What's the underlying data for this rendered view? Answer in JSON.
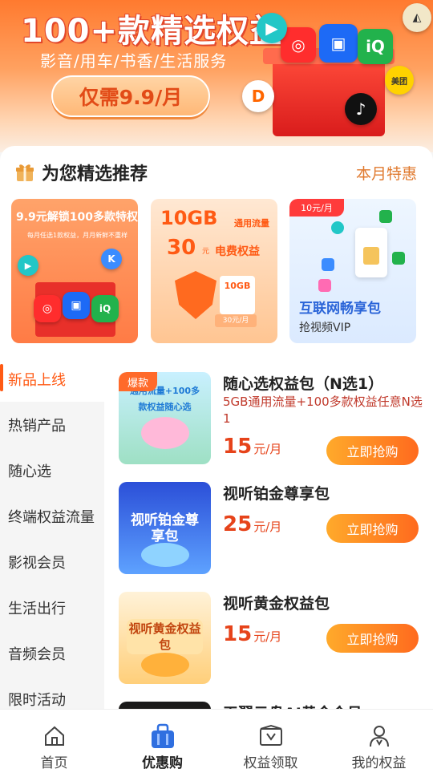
{
  "colors": {
    "accent": "#ff5a14",
    "price": "#e6431a",
    "buy_gradient_start": "#ffaa2b",
    "buy_gradient_end": "#ff6a1e",
    "section_more": "#e07a2f"
  },
  "banner": {
    "title": "100+款精选权益",
    "subtitle": "影音/用车/书香/生活服务",
    "cta": "仅需9.9/月",
    "icons": [
      "netease-music-icon",
      "youku-icon",
      "iqiyi-icon",
      "tiktok-icon",
      "meituan-icon",
      "didi-icon",
      "tencent-video-icon",
      "petrochina-icon"
    ]
  },
  "recommend": {
    "title": "为您精选推荐",
    "more": "本月特惠",
    "cards": [
      {
        "title": "9.9元解锁100多款特权",
        "subtitle": "每月任选1款权益，月月新鲜不重样"
      },
      {
        "big": "10GB",
        "small": "通用流量",
        "amount": "30",
        "yuan": "元",
        "benefit": "电费权益",
        "tag": "10GB",
        "price": "30元/月"
      },
      {
        "tag": "10元/月",
        "title": "互联网畅享包",
        "subtitle": "抢视频VIP"
      }
    ]
  },
  "categories": [
    {
      "label": "新品上线",
      "active": true
    },
    {
      "label": "热销产品",
      "active": false
    },
    {
      "label": "随心选",
      "active": false
    },
    {
      "label": "终端权益流量",
      "active": false
    },
    {
      "label": "影视会员",
      "active": false
    },
    {
      "label": "生活出行",
      "active": false
    },
    {
      "label": "音频会员",
      "active": false
    },
    {
      "label": "限时活动",
      "active": false
    }
  ],
  "products": [
    {
      "badge": "爆款",
      "thumb_label": "通用流量+100多款权益随心选",
      "title": "随心选权益包（N选1）",
      "desc": "5GB通用流量+100多款权益任意N选1",
      "price": "15",
      "unit": "元/月",
      "button": "立即抢购"
    },
    {
      "badge": "",
      "thumb_label": "视听铂金尊享包",
      "title": "视听铂金尊享包",
      "desc": "",
      "price": "25",
      "unit": "元/月",
      "button": "立即抢购"
    },
    {
      "badge": "",
      "thumb_label": "视听黄金权益包",
      "title": "视听黄金权益包",
      "desc": "",
      "price": "15",
      "unit": "元/月",
      "button": "立即抢购"
    },
    {
      "badge": "",
      "thumb_label": "",
      "title": "天翼云盘AI黄金会员",
      "desc": "",
      "price": "",
      "unit": "",
      "button": ""
    }
  ],
  "tabs": [
    {
      "label": "首页",
      "icon": "home-icon",
      "active": false
    },
    {
      "label": "优惠购",
      "icon": "shopping-bag-icon",
      "active": true
    },
    {
      "label": "权益领取",
      "icon": "voucher-icon",
      "active": false
    },
    {
      "label": "我的权益",
      "icon": "user-icon",
      "active": false
    }
  ]
}
